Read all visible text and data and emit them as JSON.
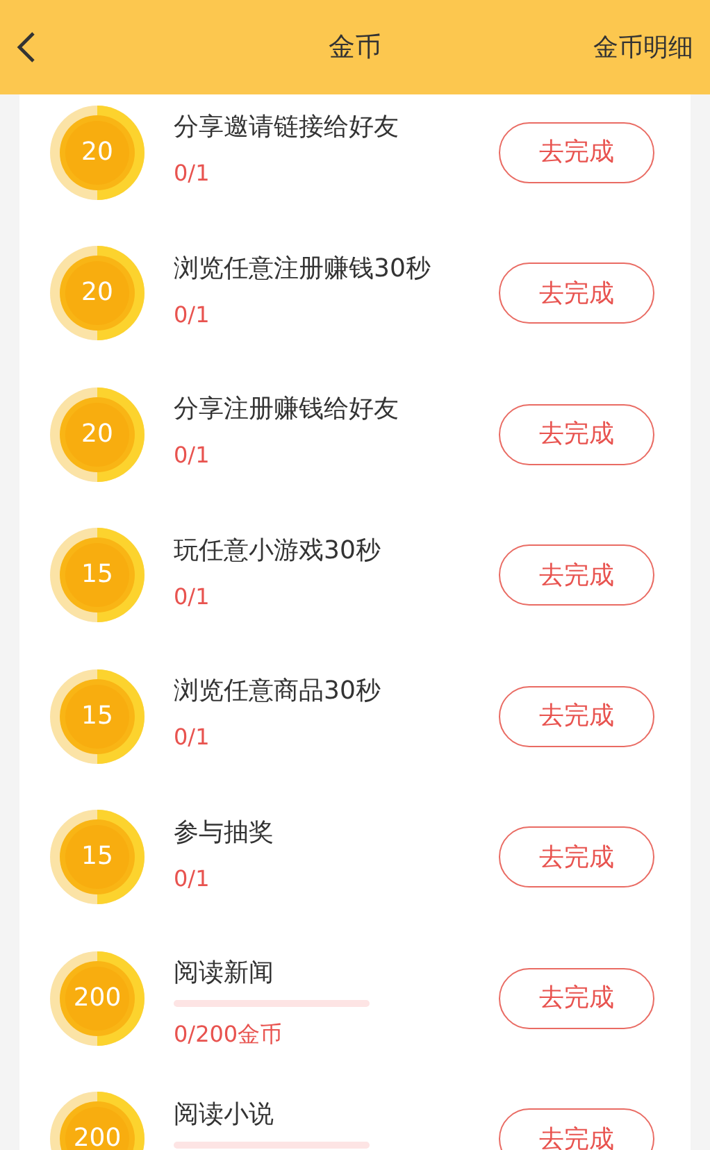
{
  "header": {
    "title": "金币",
    "link": "金币明细"
  },
  "tasks": [
    {
      "kind": "count",
      "coins": "20",
      "title": "分享邀请链接给好友",
      "progress": "0/1",
      "button": "去完成"
    },
    {
      "kind": "count",
      "coins": "20",
      "title": "浏览任意注册赚钱30秒",
      "progress": "0/1",
      "button": "去完成"
    },
    {
      "kind": "count",
      "coins": "20",
      "title": "分享注册赚钱给好友",
      "progress": "0/1",
      "button": "去完成"
    },
    {
      "kind": "count",
      "coins": "15",
      "title": "玩任意小游戏30秒",
      "progress": "0/1",
      "button": "去完成"
    },
    {
      "kind": "count",
      "coins": "15",
      "title": "浏览任意商品30秒",
      "progress": "0/1",
      "button": "去完成"
    },
    {
      "kind": "count",
      "coins": "15",
      "title": "参与抽奖",
      "progress": "0/1",
      "button": "去完成"
    },
    {
      "kind": "bar",
      "coins": "200",
      "title": "阅读新闻",
      "level": 0,
      "progress": "0/200金币",
      "button": "去完成"
    },
    {
      "kind": "bar",
      "coins": "200",
      "title": "阅读小说",
      "level": 0,
      "button": "去完成"
    }
  ]
}
